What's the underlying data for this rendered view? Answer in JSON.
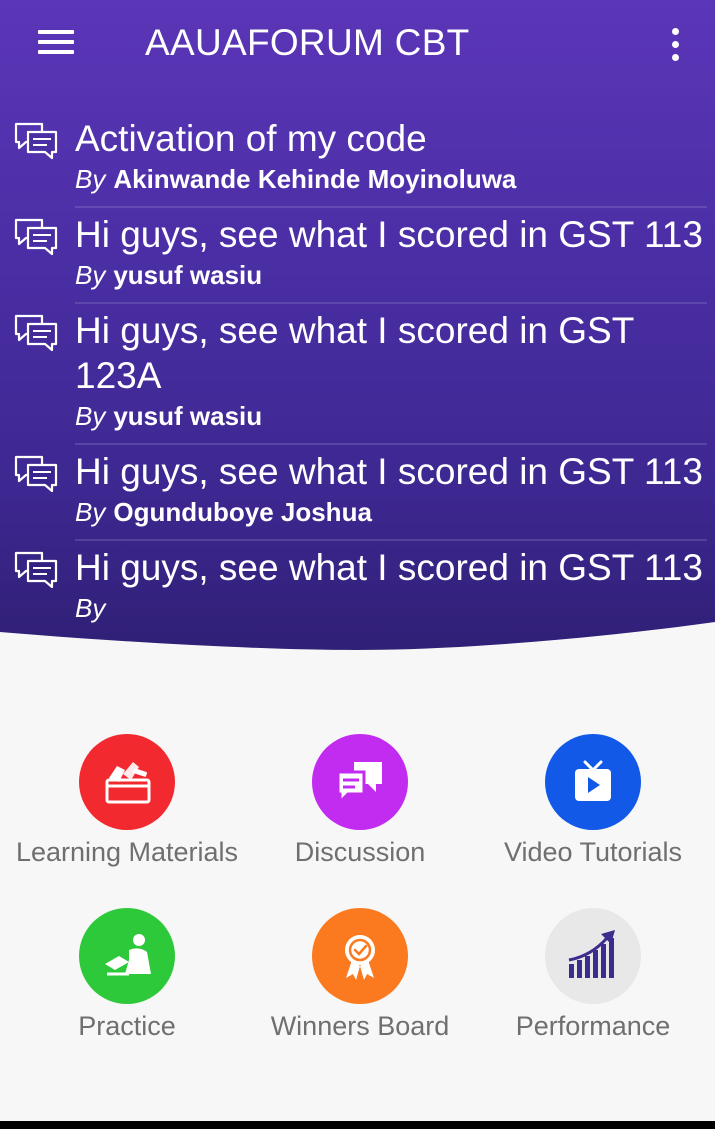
{
  "app_bar": {
    "title": "AAUAFORUM CBT"
  },
  "posts": [
    {
      "title": "Activation of my code",
      "by": "By",
      "author": "Akinwande  Kehinde Moyinoluwa"
    },
    {
      "title": "Hi guys, see what I scored in GST 113",
      "by": "By",
      "author": "yusuf wasiu"
    },
    {
      "title": "Hi guys, see what I scored in GST 123A",
      "by": "By",
      "author": "yusuf wasiu"
    },
    {
      "title": "Hi guys, see what I scored in GST 113",
      "by": "By",
      "author": "Ogunduboye Joshua"
    },
    {
      "title": "Hi guys, see what I scored in GST 113",
      "by": "By",
      "author": ""
    }
  ],
  "menu": [
    {
      "label": "Learning Materials",
      "icon": "books-icon",
      "color": "#f2292e"
    },
    {
      "label": "Discussion",
      "icon": "chat-bubbles-icon",
      "color": "#c22bf0"
    },
    {
      "label": "Video Tutorials",
      "icon": "tv-play-icon",
      "color": "#1259e8"
    },
    {
      "label": "Practice",
      "icon": "student-desk-icon",
      "color": "#2ec93a"
    },
    {
      "label": "Winners Board",
      "icon": "award-ribbon-icon",
      "color": "#fb7a1f"
    },
    {
      "label": "Performance",
      "icon": "growth-chart-icon",
      "color": "#e8e8e8"
    }
  ],
  "colors": {
    "header_top": "#5b36b8",
    "header_bottom": "#2f1f74",
    "background": "#f7f7f7",
    "label_text": "#6f6f6f"
  }
}
